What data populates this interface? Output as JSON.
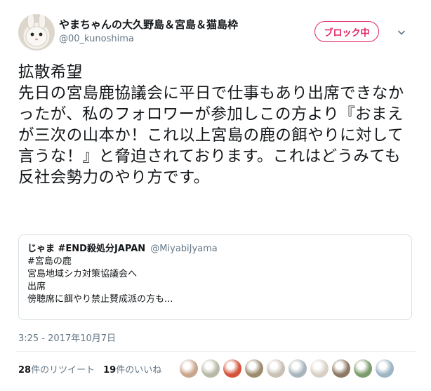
{
  "header": {
    "display_name": "やまちゃんの大久野島＆宮島＆猫島枠",
    "handle": "@00_kunoshima",
    "block_button_label": "ブロック中"
  },
  "tweet": {
    "text": "拡散希望\n先日の宮島鹿協議会に平日で仕事もあり出席できなかったが、私のフォロワーが参加しこの方より『おまえが三次の山本か！これ以上宮島の鹿の餌やりに対して言うな！』と脅迫されております。これはどうみても反社会勢力のやり方です。",
    "timestamp": "3:25 - 2017年10月7日"
  },
  "quote": {
    "name": "じゃま #END殺処分JAPAN",
    "handle": "@MiyabiJyama",
    "lines": [
      "#宮島の鹿",
      "宮島地域シカ対策協議会へ",
      "出席",
      "傍聴席に餌やり禁止賛成派の方も..."
    ]
  },
  "stats": {
    "retweet_count": "28",
    "retweet_label": "件のリツイート",
    "like_count": "19",
    "like_label": "件のいいね"
  },
  "likers": {
    "colors": [
      "#c9a58c",
      "#b8b8a6",
      "#d4533a",
      "#9c8c6e",
      "#c8c0b4",
      "#a8b4bc",
      "#d8d0c4",
      "#8c7864",
      "#7c9c6c",
      "#9cb4c4"
    ]
  },
  "colors": {
    "accent_block": "#e0245e",
    "secondary_text": "#657786",
    "border": "#d8dfe3"
  }
}
